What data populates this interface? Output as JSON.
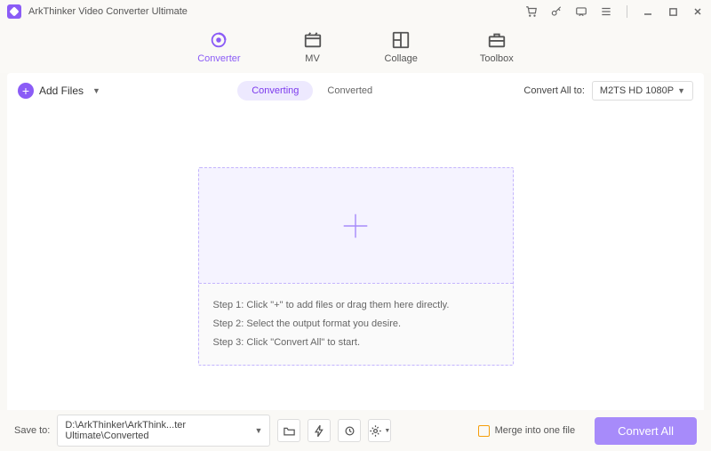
{
  "app": {
    "title": "ArkThinker Video Converter Ultimate"
  },
  "tabs": [
    {
      "label": "Converter",
      "active": true
    },
    {
      "label": "MV"
    },
    {
      "label": "Collage"
    },
    {
      "label": "Toolbox"
    }
  ],
  "toolbar": {
    "add_files": "Add Files",
    "modes": {
      "converting": "Converting",
      "converted": "Converted"
    },
    "convert_all_to": "Convert All to:",
    "format": "M2TS HD 1080P"
  },
  "dropzone": {
    "step1": "Step 1: Click \"+\" to add files or drag them here directly.",
    "step2": "Step 2: Select the output format you desire.",
    "step3": "Step 3: Click \"Convert All\" to start."
  },
  "footer": {
    "save_to": "Save to:",
    "path": "D:\\ArkThinker\\ArkThink...ter Ultimate\\Converted",
    "merge": "Merge into one file",
    "convert_all": "Convert All"
  }
}
